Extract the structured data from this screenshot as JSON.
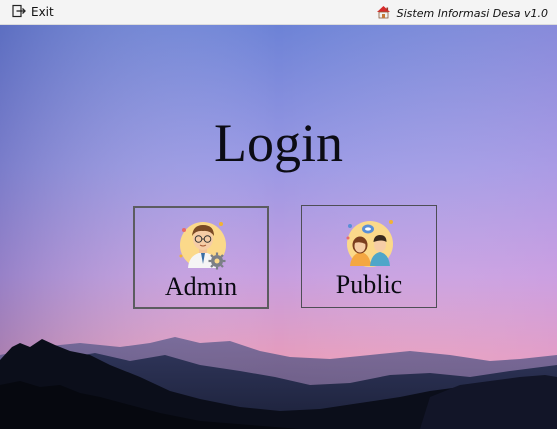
{
  "menubar": {
    "exit_label": "Exit",
    "exit_icon": "exit-icon",
    "app_title": "Sistem Informasi Desa v1.0",
    "app_icon": "home-icon"
  },
  "login": {
    "heading": "Login",
    "options": [
      {
        "label": "Admin",
        "icon": "admin-avatar-icon"
      },
      {
        "label": "Public",
        "icon": "public-users-icon"
      }
    ]
  },
  "colors": {
    "sky_top": "#6f84d8",
    "sky_mid": "#a69be6",
    "sky_horizon": "#e89ab4",
    "mountains": "#0a0d18"
  }
}
